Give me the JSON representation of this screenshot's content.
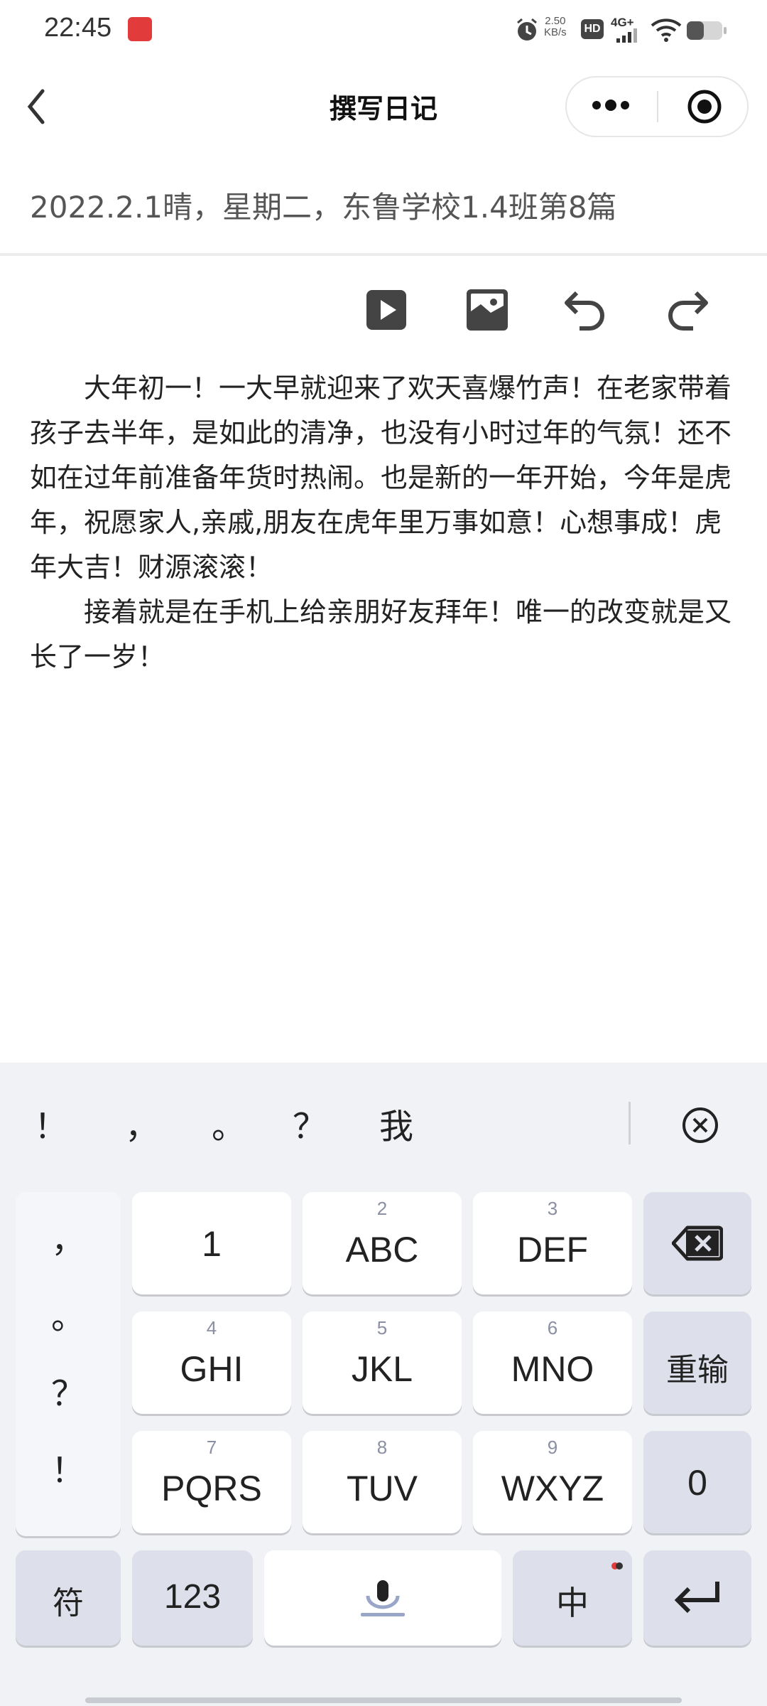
{
  "status_bar": {
    "time": "22:45",
    "net_speed": "2.50\nKB/s",
    "hd": "HD",
    "network": "4G+",
    "icons": [
      "notification-app-icon",
      "alarm-icon",
      "signal-icon",
      "wifi-icon",
      "battery-icon"
    ]
  },
  "header": {
    "title": "撰写日记",
    "icons": [
      "back-icon",
      "more-icon",
      "close-target-icon"
    ]
  },
  "diary": {
    "title_line": "2022.2.1晴，星期二，东鲁学校1.4班第8篇",
    "paragraphs": [
      "大年初一！一大早就迎来了欢天喜爆竹声！在老家带着孩子去半年，是如此的清净，也没有小时过年的气氛！还不如在过年前准备年货时热闹。也是新的一年开始，今年是虎年，祝愿家人,亲戚,朋友在虎年里万事如意！心想事成！虎年大吉！财源滚滚！",
      "接着就是在手机上给亲朋好友拜年！唯一的改变就是又长了一岁！"
    ]
  },
  "toolbar": {
    "icons": [
      "video-icon",
      "image-icon",
      "undo-icon",
      "redo-icon"
    ]
  },
  "keyboard": {
    "candidates": [
      "！",
      "，",
      "。",
      "？",
      "我"
    ],
    "punct_column": [
      "，",
      "。",
      "？",
      "！"
    ],
    "keys": [
      {
        "num": "",
        "label": "1"
      },
      {
        "num": "2",
        "label": "ABC"
      },
      {
        "num": "3",
        "label": "DEF"
      },
      {
        "num": "4",
        "label": "GHI"
      },
      {
        "num": "5",
        "label": "JKL"
      },
      {
        "num": "6",
        "label": "MNO"
      },
      {
        "num": "7",
        "label": "PQRS"
      },
      {
        "num": "8",
        "label": "TUV"
      },
      {
        "num": "9",
        "label": "WXYZ"
      }
    ],
    "reset": "重输",
    "zero": "0",
    "symbols": "符",
    "numbers": "123",
    "lang": "中"
  }
}
